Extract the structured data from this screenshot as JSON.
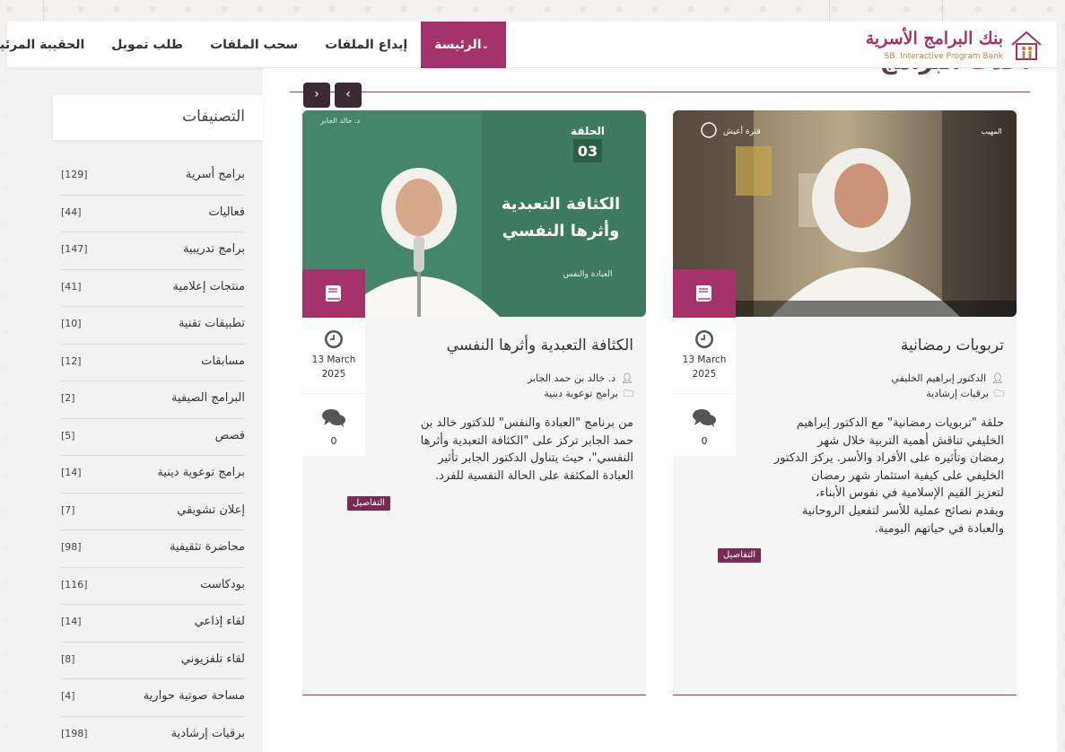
{
  "header": {
    "logo_ar": "بنك البرامج الأسرية",
    "logo_en": "SB. Interactive Program Bank",
    "nav": [
      {
        "label": "الرئيسة",
        "active": true
      },
      {
        "label": "إيداع الملفات",
        "active": false
      },
      {
        "label": "سحب الملفات",
        "active": false
      },
      {
        "label": "طلب تمويل",
        "active": false
      },
      {
        "label": "الحقيبة المرئية",
        "active": false
      }
    ]
  },
  "section_title": {
    "accent": "أحدث",
    "rest": "البرامج"
  },
  "carousel": {
    "prev_icon": "‹",
    "next_icon": "›"
  },
  "sidebar": {
    "title": "التصنيفات",
    "categories": [
      {
        "name": "برامج أسرية",
        "count": "[129]"
      },
      {
        "name": "فعاليات",
        "count": "[44]"
      },
      {
        "name": "برامج تدريبية",
        "count": "[147]"
      },
      {
        "name": "منتجات إعلامية",
        "count": "[41]"
      },
      {
        "name": "تطبيقات تقنية",
        "count": "[10]"
      },
      {
        "name": "مسابقات",
        "count": "[12]"
      },
      {
        "name": "البرامج الصيفية",
        "count": "[2]"
      },
      {
        "name": "قصص",
        "count": "[5]"
      },
      {
        "name": "برامج توعوية دينية",
        "count": "[14]"
      },
      {
        "name": "إعلان تشويقي",
        "count": "[7]"
      },
      {
        "name": "محاضرة تثقيفية",
        "count": "[98]"
      },
      {
        "name": "بودكاست",
        "count": "[116]"
      },
      {
        "name": "لقاء إذاعي",
        "count": "[14]"
      },
      {
        "name": "لقاء تلفزيوني",
        "count": "[8]"
      },
      {
        "name": "مساحة صوتية حوارية",
        "count": "[4]"
      },
      {
        "name": "برقيات إرشادية",
        "count": "[198]"
      }
    ]
  },
  "cards": [
    {
      "title": "تربويات رمضانية",
      "author": "الدكتور إبراهيم الخليفي",
      "category": "برقيات إرشادية",
      "date_line1": "13 March",
      "date_line2": "2025",
      "comments": "0",
      "description_lines": [
        "حلقة \"تربويات رمضانية\" مع الدكتور إبراهيم",
        "الخليفي تناقش أهمية التربية خلال شهر",
        "رمضان وتأثيره على الأفراد والأسر. يركز الدكتور",
        "الخليفي على كيفية استثمار شهر رمضان",
        "لتعزيز القيم الإسلامية في نفوس الأبناء،",
        "ويقدم نصائح عملية للأسر لتفعيل الروحانية",
        "والعبادة في حياتهم اليومية."
      ],
      "details_label": "التفاصيل",
      "image": {
        "logo_text": "فترة أعيش",
        "corner_text": "المهيب"
      }
    },
    {
      "title": "الكثافة التعبدية وأثرها النفسي",
      "author": "د. خالد بن حمد الجابر",
      "category": "برامج توعوية دينية",
      "date_line1": "13 March",
      "date_line2": "2025",
      "comments": "0",
      "description_lines": [
        "من برنامج \"العبادة والنفس\" للدكتور خالد بن",
        "حمد الجابر تركز على \"الكثافة التعبدية وأثرها",
        "النفسي\"، حيث يتناول الدكتور الجابر تأثير",
        "العبادة المكثفة على الحالة النفسية للفرد."
      ],
      "details_label": "التفاصيل",
      "image": {
        "episode_label": "الحلقة",
        "episode_number": "03",
        "headline_1": "الكثافة التعبدية",
        "headline_2": "وأثرها النفسي",
        "series": "العبادة والنفس",
        "signature": "د. خالد الجابر"
      }
    }
  ],
  "colors": {
    "accent": "#a3336a",
    "dark": "#3b2a33",
    "green": "#2f6b4f"
  }
}
